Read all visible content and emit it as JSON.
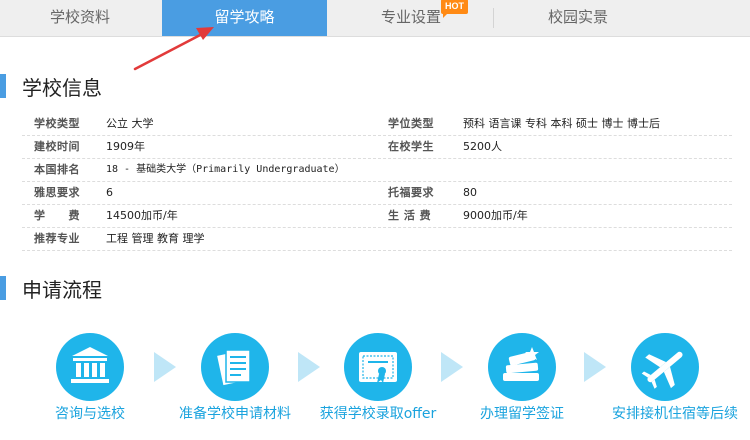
{
  "tabs": {
    "school_info": "学校资料",
    "study_guide": "留学攻略",
    "majors": "专业设置",
    "majors_badge": "HOT",
    "campus": "校园实景"
  },
  "school_section": {
    "title": "学校信息",
    "rows": [
      {
        "l1": "学校类型",
        "v1": "公立 大学",
        "l2": "学位类型",
        "v2": "预科 语言课 专科 本科 硕士 博士 博士后"
      },
      {
        "l1": "建校时间",
        "v1": "1909年",
        "l2": "在校学生",
        "v2": "5200人"
      },
      {
        "l1": "本国排名",
        "v1": "18 - 基础类大学（Primarily Undergraduate）"
      },
      {
        "l1": "雅思要求",
        "v1": "6",
        "l2": "托福要求",
        "v2": "80"
      },
      {
        "l1": "学　　费",
        "v1": "14500加币/年",
        "l2": "生 活 费",
        "v2": "9000加币/年"
      },
      {
        "l1": "推荐专业",
        "v1": "工程 管理 教育 理学"
      }
    ]
  },
  "process_section": {
    "title": "申请流程",
    "steps": [
      {
        "label": "咨询与选校",
        "icon": "school-building-icon"
      },
      {
        "label": "准备学校申请材料",
        "icon": "document-icon"
      },
      {
        "label": "获得学校录取offer",
        "icon": "certificate-icon"
      },
      {
        "label": "办理留学签证",
        "icon": "books-icon"
      },
      {
        "label": "安排接机住宿等后续",
        "icon": "airplane-icon"
      }
    ]
  },
  "colors": {
    "accent": "#4a9de2",
    "step_circle": "#1fb5ea",
    "step_text": "#1aa3de",
    "hot_badge": "#ff8a14",
    "arrow": "#e23a3a"
  }
}
